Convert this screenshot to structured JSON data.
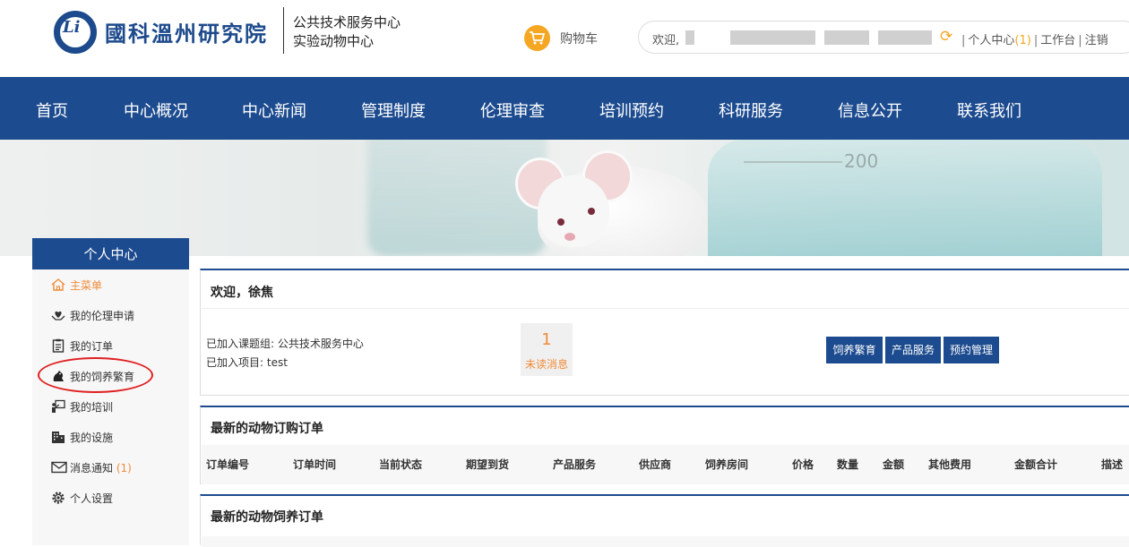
{
  "header": {
    "logo_title": "國科溫州研究院",
    "logo_mark": "Li",
    "subtitle_line1": "公共技术服务中心",
    "subtitle_line2": "实验动物中心",
    "cart_label": "购物车",
    "welcome_prefix": "欢迎,",
    "user_center": "个人中心",
    "user_center_count": "(1)",
    "workbench": "工作台",
    "logout": "注销",
    "separator": "|"
  },
  "nav": {
    "items": [
      "首页",
      "中心概况",
      "中心新闻",
      "管理制度",
      "伦理审查",
      "培训预约",
      "科研服务",
      "信息公开",
      "联系我们"
    ]
  },
  "banner": {
    "flask_scale_label": "200"
  },
  "sidebar": {
    "title": "个人中心",
    "items": [
      {
        "label": "主菜单",
        "icon": "home-icon"
      },
      {
        "label": "我的伦理申请",
        "icon": "heart-hand-icon"
      },
      {
        "label": "我的订单",
        "icon": "clipboard-icon"
      },
      {
        "label": "我的饲养繁育",
        "icon": "animal-icon"
      },
      {
        "label": "我的培训",
        "icon": "training-icon"
      },
      {
        "label": "我的设施",
        "icon": "building-icon"
      },
      {
        "label": "消息通知",
        "icon": "mail-icon",
        "count": "(1)"
      },
      {
        "label": "个人设置",
        "icon": "gear-icon"
      }
    ]
  },
  "welcome_panel": {
    "title": "欢迎，徐焦",
    "group_line": "已加入课题组: 公共技术服务中心",
    "project_line": "已加入项目: test",
    "unread_count": "1",
    "unread_label": "未读消息",
    "buttons": [
      "饲养繁育",
      "产品服务",
      "预约管理"
    ]
  },
  "orders_panel": {
    "title": "最新的动物订购订单",
    "columns": [
      "订单编号",
      "订单时间",
      "当前状态",
      "期望到货",
      "产品服务",
      "供应商",
      "饲养房间",
      "价格",
      "数量",
      "金额",
      "其他费用",
      "金额合计",
      "描述"
    ]
  },
  "breeding_panel": {
    "title": "最新的动物饲养订单"
  },
  "colors": {
    "brand_blue": "#1c4b8f",
    "accent_orange": "#f08c3a",
    "cart_orange": "#f5a623"
  }
}
